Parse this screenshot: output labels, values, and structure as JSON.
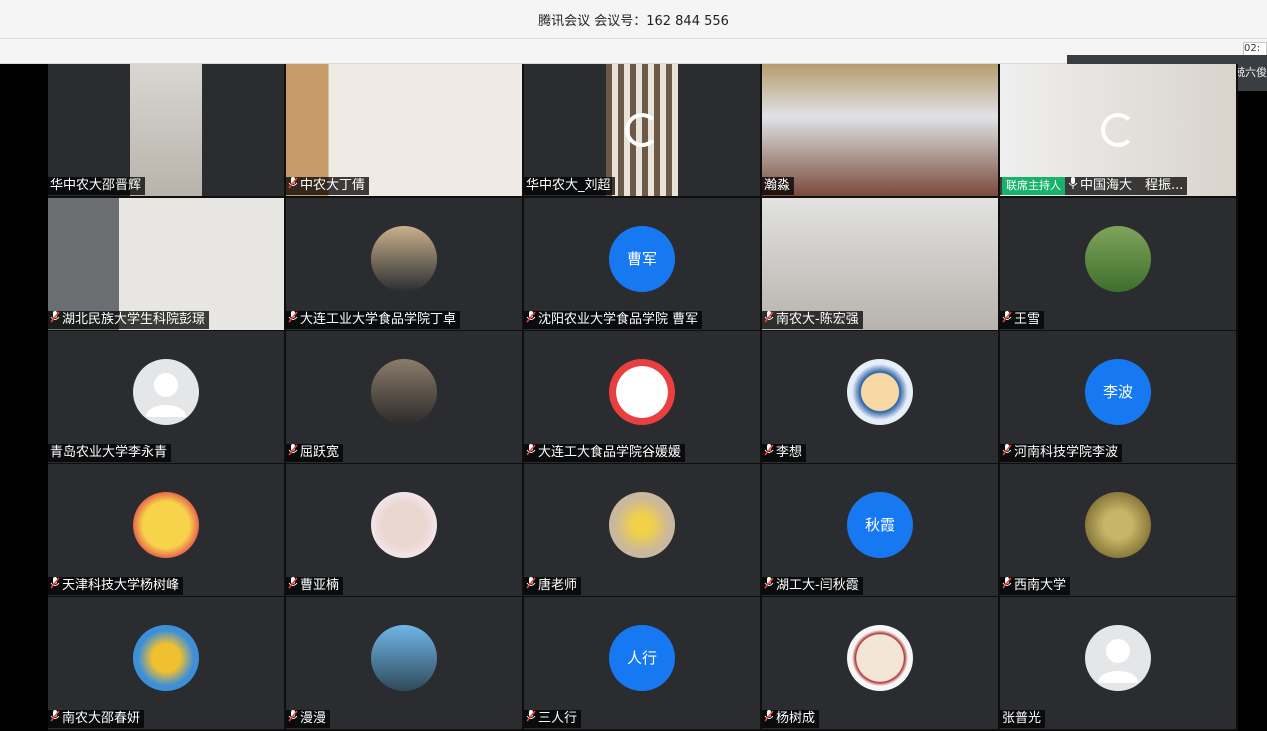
{
  "window": {
    "title": "腾讯会议 会议号：162 844 556",
    "timer_text": "02:",
    "side_text": "兢六俊"
  },
  "host_badge": "联席主持人",
  "icons": {
    "mic_muted": "mic-muted-icon",
    "mic_on": "mic-icon",
    "loading": "spinner-icon"
  },
  "colors": {
    "avatar_blue": "#1679f2",
    "host_green": "#17b36a",
    "tile_bg": "#2a2c30"
  },
  "participants": [
    {
      "name": "华中农大邵晋辉",
      "mic": "none"
    },
    {
      "name": "中农大丁倩",
      "mic": "muted"
    },
    {
      "name": "华中农大_刘超",
      "mic": "none"
    },
    {
      "name": "瀚淼",
      "mic": "none"
    },
    {
      "name": "中国海大　程振...",
      "mic": "on",
      "host": true
    },
    {
      "name": "湖北民族大学生科院彭璟",
      "mic": "muted"
    },
    {
      "name": "大连工业大学食品学院丁卓",
      "mic": "muted"
    },
    {
      "name": "沈阳农业大学食品学院 曹军",
      "mic": "muted",
      "avatar_text": "曹军"
    },
    {
      "name": "南农大-陈宏强",
      "mic": "muted"
    },
    {
      "name": "王雪",
      "mic": "muted"
    },
    {
      "name": "青岛农业大学李永青",
      "mic": "none"
    },
    {
      "name": "屈跃宽",
      "mic": "muted"
    },
    {
      "name": "大连工大食品学院谷媛媛",
      "mic": "muted"
    },
    {
      "name": "李想",
      "mic": "muted"
    },
    {
      "name": "河南科技学院李波",
      "mic": "muted",
      "avatar_text": "李波"
    },
    {
      "name": "天津科技大学杨树峰",
      "mic": "muted"
    },
    {
      "name": "曹亚楠",
      "mic": "muted"
    },
    {
      "name": "唐老师",
      "mic": "muted"
    },
    {
      "name": "湖工大-闫秋霞",
      "mic": "muted",
      "avatar_text": "秋霞"
    },
    {
      "name": "西南大学",
      "mic": "muted"
    },
    {
      "name": "南农大邵春妍",
      "mic": "muted"
    },
    {
      "name": "漫漫",
      "mic": "muted"
    },
    {
      "name": "三人行",
      "mic": "muted",
      "avatar_text": "人行"
    },
    {
      "name": "杨树成",
      "mic": "muted"
    },
    {
      "name": "张普光",
      "mic": "none"
    }
  ]
}
